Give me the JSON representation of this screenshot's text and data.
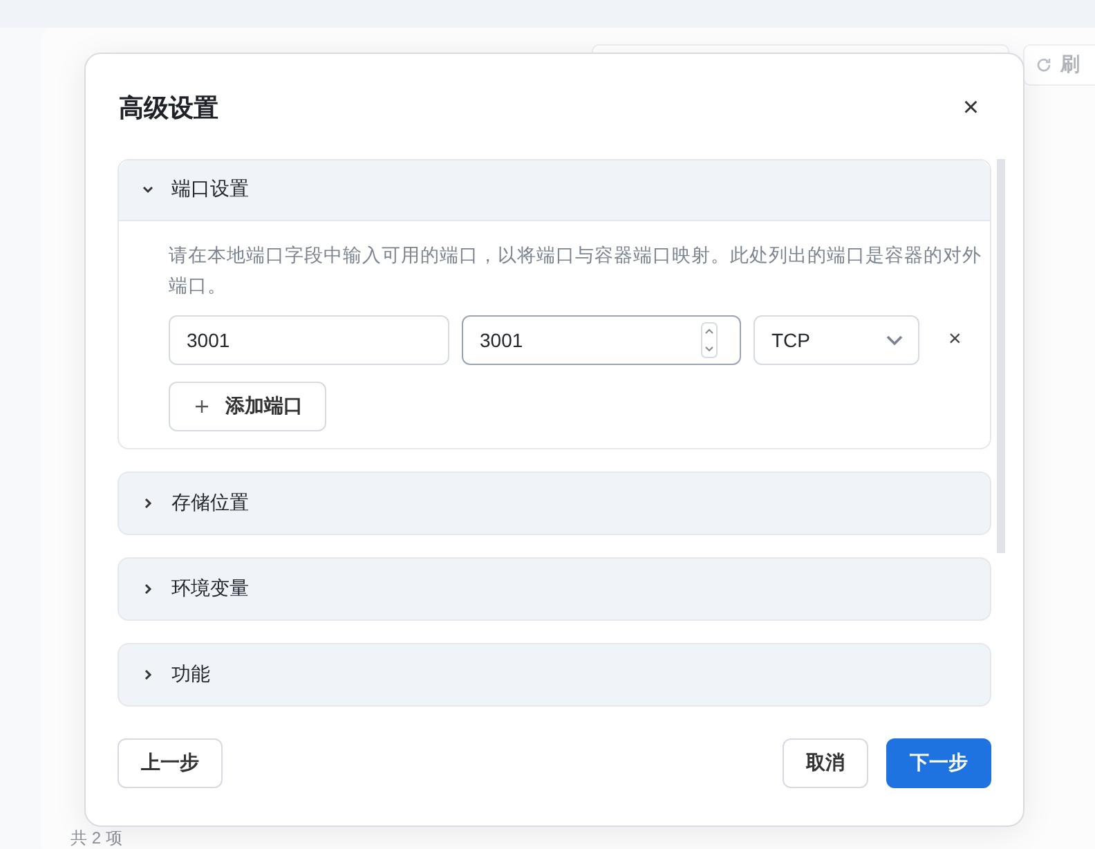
{
  "background": {
    "refresh_button": "刷",
    "footer": "共 2 项"
  },
  "dialog": {
    "title": "高级设置",
    "close": "×",
    "sections": [
      {
        "title": "端口设置",
        "expanded": true,
        "description": "请在本地端口字段中输入可用的端口，以将端口与容器端口映射。此处列出的端口是容器的对外端口。",
        "ports": [
          {
            "host_port": "3001",
            "container_port": "3001",
            "protocol": "TCP",
            "remove": "×"
          }
        ],
        "add_button": "添加端口"
      },
      {
        "title": "存储位置",
        "expanded": false
      },
      {
        "title": "环境变量",
        "expanded": false
      },
      {
        "title": "功能",
        "expanded": false
      }
    ],
    "buttons": {
      "back": "上一步",
      "cancel": "取消",
      "next": "下一步"
    }
  }
}
